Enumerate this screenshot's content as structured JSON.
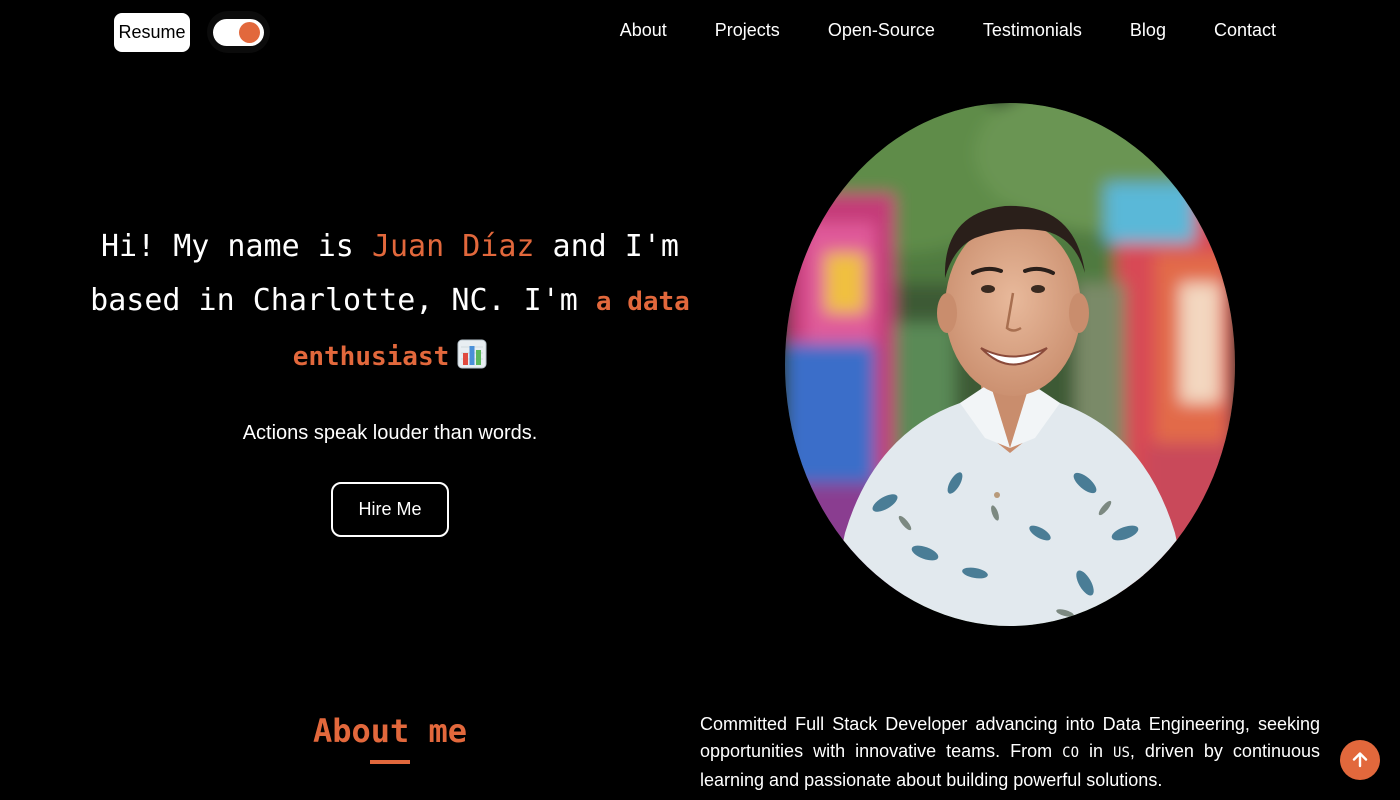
{
  "header": {
    "resume_label": "Resume",
    "theme_toggle": {
      "state": "on",
      "accent": "#e2683c"
    },
    "nav": [
      {
        "label": "About"
      },
      {
        "label": "Projects"
      },
      {
        "label": "Open-Source"
      },
      {
        "label": "Testimonials"
      },
      {
        "label": "Blog"
      },
      {
        "label": "Contact"
      }
    ]
  },
  "hero": {
    "intro_1": "Hi! My name is ",
    "name": "Juan Díaz",
    "intro_2": " and I'm based in Charlotte, NC. I'm ",
    "role": "a data enthusiast",
    "role_icon": "bar-chart-emoji",
    "tagline": "Actions speak louder than words.",
    "hire_label": "Hire Me"
  },
  "about": {
    "title": "About me",
    "desc_1": "Committed Full Stack Developer advancing into Data Engineering, seeking opportunities with innovative teams. From ",
    "flag_from": "CO",
    "desc_2": " in ",
    "flag_to": "US",
    "desc_3": ", driven by continuous learning and passionate about building powerful solutions."
  },
  "scroll_top": {
    "icon": "arrow-up-icon"
  },
  "colors": {
    "background": "#000000",
    "accent": "#e2683c",
    "text": "#ffffff"
  }
}
